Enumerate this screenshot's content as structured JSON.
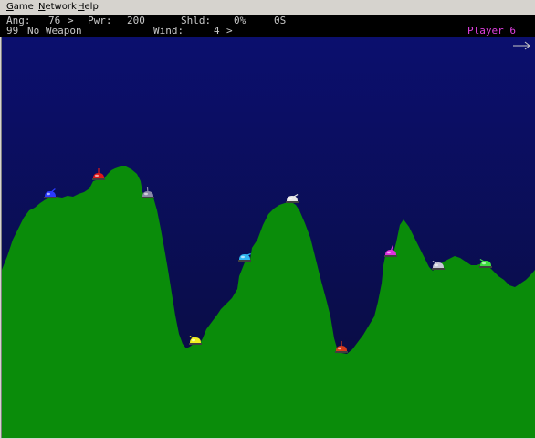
{
  "menubar": {
    "items": [
      {
        "mnemonic": "G",
        "rest": "ame"
      },
      {
        "mnemonic": "N",
        "rest": "etwork"
      },
      {
        "mnemonic": "H",
        "rest": "elp"
      }
    ]
  },
  "hud": {
    "angle_label": "Ang:",
    "angle_value": "76",
    "angle_arrow": ">",
    "power_label": "Pwr:",
    "power_value": "200",
    "shield_label": "Shld:",
    "shield_value": "0%",
    "shield_extra": "0S",
    "weapon_count": "99",
    "weapon_name": "No Weapon",
    "wind_label": "Wind:",
    "wind_value": "4",
    "wind_arrow": ">",
    "current_player": "Player 6",
    "wind_direction_icon": "right-arrow-icon"
  },
  "colors": {
    "sky_top": "#0b0f6e",
    "sky_bottom": "#0a0c3c",
    "terrain": "#0a8c0a",
    "hud_text": "#c8c8c8",
    "player_text": "#e040e0"
  },
  "tanks": [
    {
      "name": "tank-blue",
      "color": "#2a3aff"
    },
    {
      "name": "tank-red",
      "color": "#e01818"
    },
    {
      "name": "tank-gray",
      "color": "#8a8aa8"
    },
    {
      "name": "tank-yellow",
      "color": "#f0f020"
    },
    {
      "name": "tank-cyan",
      "color": "#30b8f0"
    },
    {
      "name": "tank-white",
      "color": "#e8e8e8"
    },
    {
      "name": "tank-orange",
      "color": "#d83a1a"
    },
    {
      "name": "tank-magenta",
      "color": "#e030e0"
    },
    {
      "name": "tank-lightgray",
      "color": "#c8c8d8"
    },
    {
      "name": "tank-green",
      "color": "#40e040"
    }
  ]
}
